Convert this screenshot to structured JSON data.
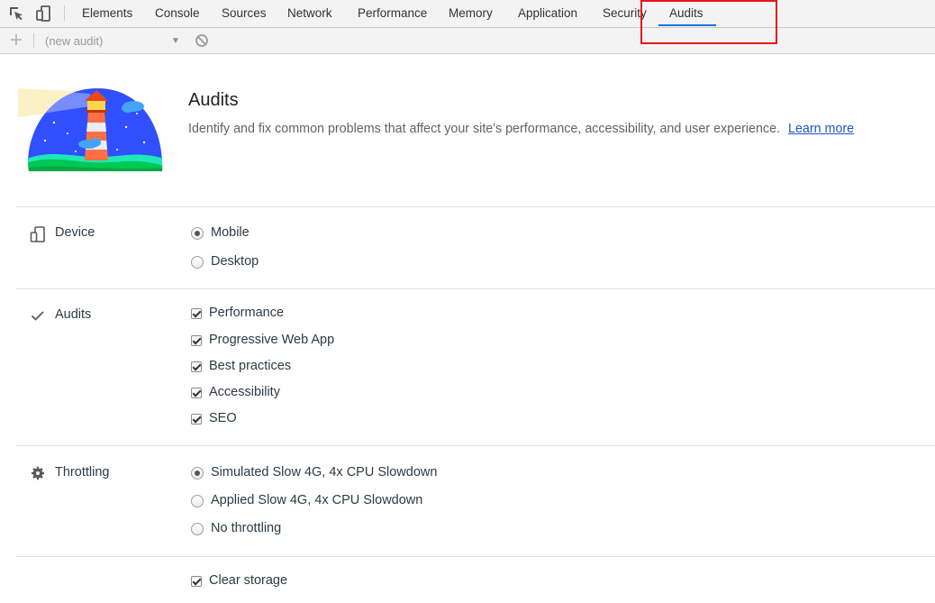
{
  "tabs": [
    {
      "label": "Elements"
    },
    {
      "label": "Console"
    },
    {
      "label": "Sources"
    },
    {
      "label": "Network"
    },
    {
      "label": "Performance"
    },
    {
      "label": "Memory"
    },
    {
      "label": "Application"
    },
    {
      "label": "Security"
    },
    {
      "label": "Audits"
    }
  ],
  "active_tab": "Audits",
  "toolbar": {
    "audit_select_value": "(new audit)"
  },
  "header": {
    "title": "Audits",
    "description": "Identify and fix common problems that affect your site's performance, accessibility, and user experience.",
    "learn_more": "Learn more"
  },
  "sections": {
    "device": {
      "label": "Device",
      "options": [
        {
          "label": "Mobile",
          "checked": true
        },
        {
          "label": "Desktop",
          "checked": false
        }
      ]
    },
    "audits": {
      "label": "Audits",
      "options": [
        {
          "label": "Performance",
          "checked": true
        },
        {
          "label": "Progressive Web App",
          "checked": true
        },
        {
          "label": "Best practices",
          "checked": true
        },
        {
          "label": "Accessibility",
          "checked": true
        },
        {
          "label": "SEO",
          "checked": true
        }
      ]
    },
    "throttling": {
      "label": "Throttling",
      "options": [
        {
          "label": "Simulated Slow 4G, 4x CPU Slowdown",
          "checked": true
        },
        {
          "label": "Applied Slow 4G, 4x CPU Slowdown",
          "checked": false
        },
        {
          "label": "No throttling",
          "checked": false
        }
      ]
    },
    "storage": {
      "options": [
        {
          "label": "Clear storage",
          "checked": true
        }
      ]
    }
  },
  "colors": {
    "highlight_box": "#e8141b",
    "active_tab_underline": "#1a73e8",
    "link": "#1a57c4"
  }
}
